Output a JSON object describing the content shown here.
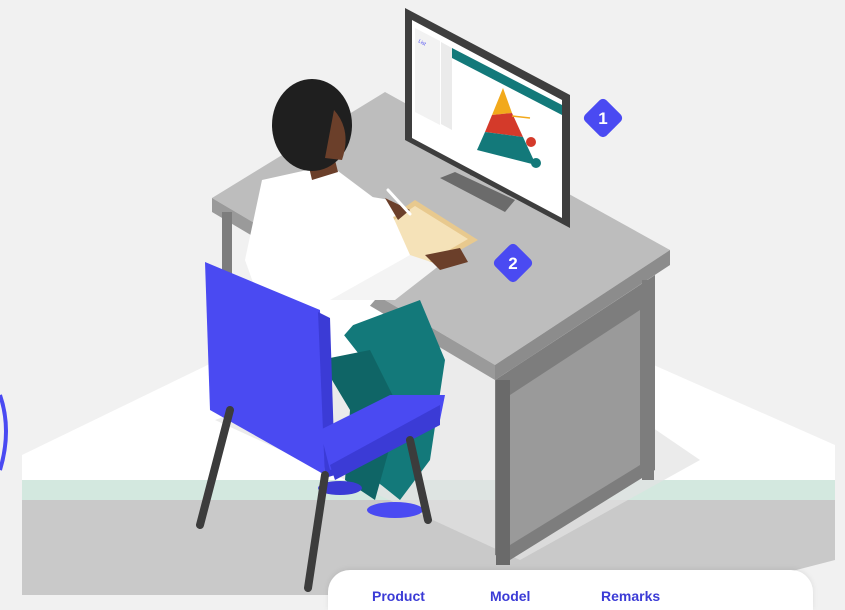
{
  "markers": [
    {
      "label": "1"
    },
    {
      "label": "2"
    }
  ],
  "monitor_sidebar": {
    "title": "List"
  },
  "table_header": {
    "columns": [
      "Product",
      "Model",
      "Remarks"
    ]
  },
  "colors": {
    "accent_blue": "#4a4af2",
    "chair_blue": "#3b3bd6",
    "platform_green": "#d3e8df",
    "desk_top": "#bdbdbd",
    "desk_side": "#7d7d7d",
    "pyramid_yellow": "#f2a91b",
    "pyramid_red": "#d43a2a",
    "pyramid_teal": "#13797a"
  }
}
